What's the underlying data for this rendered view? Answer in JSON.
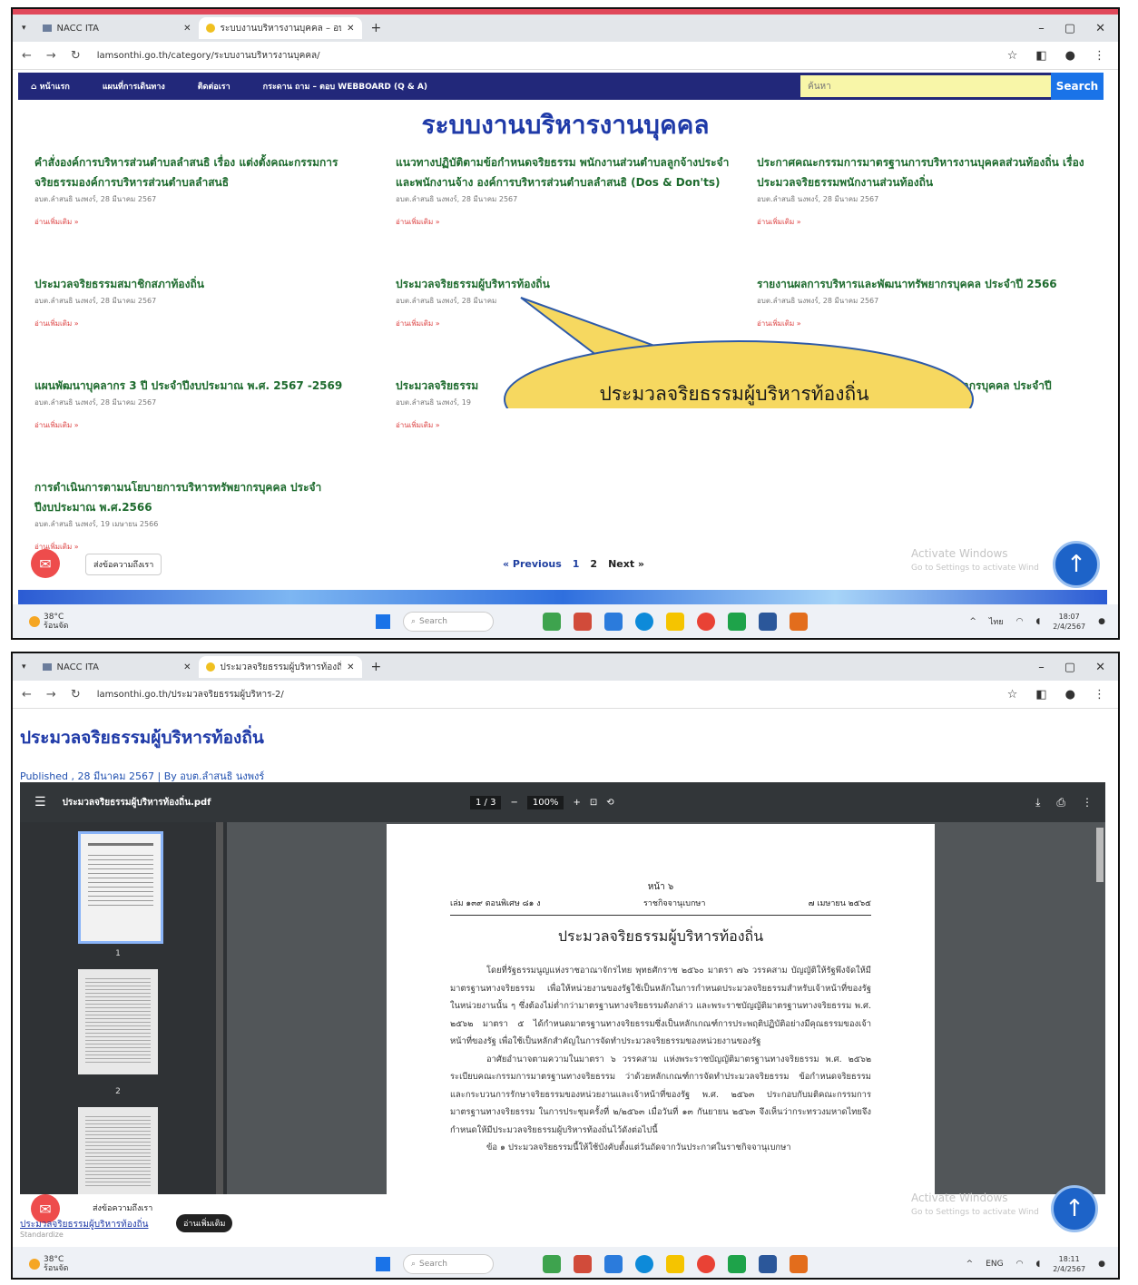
{
  "shot1": {
    "tabs": [
      {
        "title": "NACC ITA"
      },
      {
        "title": "ระบบงานบริหารงานบุคคล – อบต.ก..."
      }
    ],
    "window_controls": [
      "–",
      "▢",
      "✕"
    ],
    "url": "lamsonthi.go.th/category/ระบบงานบริหารงานบุคคล/",
    "nav_items": [
      "หน้าแรก",
      "แผนที่การเดินทาง",
      "ติดต่อเรา",
      "กระดาน ถาม – ตอบ WEBBOARD (Q & A)"
    ],
    "search_placeholder": "ค้นหา",
    "search_button": "Search",
    "page_title": "ระบบงานบริหารงานบุคคล",
    "posts": [
      {
        "title": "คำสั่งองค์การบริหารส่วนตำบลลำสนธิ เรื่อง แต่งตั้งคณะกรรมการจริยธรรมองค์การบริหารส่วนตำบลลำสนธิ",
        "meta": "อบต.ลำสนธิ นงพงร์, 28 มีนาคม 2567",
        "more": "อ่านเพิ่มเติม »"
      },
      {
        "title": "แนวทางปฏิบัติตามข้อกำหนดจริยธรรม พนักงานส่วนตำบลลูกจ้างประจำ และพนักงานจ้าง องค์การบริหารส่วนตำบลลำสนธิ (Dos & Don'ts)",
        "meta": "อบต.ลำสนธิ นงพงร์, 28 มีนาคม 2567",
        "more": "อ่านเพิ่มเติม »"
      },
      {
        "title": "ประกาศคณะกรรมการมาตรฐานการบริหารงานบุคคลส่วนท้องถิ่น เรื่อง ประมวลจริยธรรมพนักงานส่วนท้องถิ่น",
        "meta": "อบต.ลำสนธิ นงพงร์, 28 มีนาคม 2567",
        "more": "อ่านเพิ่มเติม »"
      },
      {
        "title": "ประมวลจริยธรรมสมาชิกสภาท้องถิ่น",
        "meta": "อบต.ลำสนธิ นงพงร์, 28 มีนาคม 2567",
        "more": "อ่านเพิ่มเติม »"
      },
      {
        "title": "ประมวลจริยธรรมผู้บริหารท้องถิ่น",
        "meta": "อบต.ลำสนธิ นงพงร์, 28 มีนาคม",
        "more": "อ่านเพิ่มเติม »"
      },
      {
        "title": "รายงานผลการบริหารและพัฒนาทรัพยากรบุคคล ประจำปี 2566",
        "meta": "อบต.ลำสนธิ นงพงร์, 28 มีนาคม 2567",
        "more": "อ่านเพิ่มเติม »"
      },
      {
        "title": "แผนพัฒนาบุคลากร 3 ปี ประจำปีงบประมาณ พ.ศ. 2567 -2569",
        "meta": "อบต.ลำสนธิ นงพงร์, 28 มีนาคม 2567",
        "more": "อ่านเพิ่มเติม »"
      },
      {
        "title": "ประมวลจริยธรรม",
        "meta": "อบต.ลำสนธิ นงพงร์, 19",
        "more": "อ่านเพิ่มเติม »"
      },
      {
        "title": "ยากรบุคคล ประจำปี",
        "meta": "",
        "more": ""
      },
      {
        "title": "การดำเนินการตามนโยบายการบริหารทรัพยากรบุคคล ประจำปีงบประมาณ พ.ศ.2566",
        "meta": "อบต.ลำสนธิ นงพงร์, 19 เมษายน 2566",
        "more": "อ่านเพิ่มเติม »"
      }
    ],
    "callout_text": "ประมวลจริยธรรมผู้บริหารท้องถิ่น",
    "chat_label": "ส่งข้อความถึงเรา",
    "pager": {
      "prev": "« Previous",
      "p1": "1",
      "p2": "2",
      "next": "Next »"
    },
    "activate": {
      "line1": "Activate Windows",
      "line2": "Go to Settings to activate Wind"
    },
    "weather": {
      "temp": "38°C",
      "desc": "ร้อนจัด"
    },
    "taskbar_search": "Search",
    "tray_lang": "ไทย",
    "clock": {
      "time": "18:07",
      "date": "2/4/2567"
    }
  },
  "shot2": {
    "tabs": [
      {
        "title": "NACC ITA"
      },
      {
        "title": "ประมวลจริยธรรมผู้บริหารท้องถิ่น – อ..."
      }
    ],
    "window_controls": [
      "–",
      "▢",
      "✕"
    ],
    "url": "lamsonthi.go.th/ประมวลจริยธรรมผู้บริหาร-2/",
    "post_title": "ประมวลจริยธรรมผู้บริหารท้องถิ่น",
    "published": "Published , 28 มีนาคม 2567 | By อบต.ลำสนธิ นงพงร์",
    "pdf": {
      "filename": "ประมวลจริยธรรมผู้บริหารท้องถิ่น.pdf",
      "page_indicator": "1 / 3",
      "zoom": "100%",
      "thumb_numbers": [
        "1",
        "2"
      ],
      "page_number": "หน้า ๖",
      "header_left": "เล่ม ๑๓๙ ตอนพิเศษ ๘๑ ง",
      "header_center": "ราชกิจจานุเบกษา",
      "header_right": "๗ เมษายน ๒๕๖๕",
      "doc_title": "ประมวลจริยธรรมผู้บริหารท้องถิ่น",
      "paragraphs": [
        "โดยที่รัฐธรรมนูญแห่งราชอาณาจักรไทย พุทธศักราช ๒๕๖๐ มาตรา ๗๖ วรรคสาม บัญญัติให้รัฐพึงจัดให้มีมาตรฐานทางจริยธรรม เพื่อให้หน่วยงานของรัฐใช้เป็นหลักในการกำหนดประมวลจริยธรรมสำหรับเจ้าหน้าที่ของรัฐในหน่วยงานนั้น ๆ ซึ่งต้องไม่ต่ำกว่ามาตรฐานทางจริยธรรมดังกล่าว และพระราชบัญญัติมาตรฐานทางจริยธรรม พ.ศ. ๒๕๖๒ มาตรา ๕ ได้กำหนดมาตรฐานทางจริยธรรมซึ่งเป็นหลักเกณฑ์การประพฤติปฏิบัติอย่างมีคุณธรรมของเจ้าหน้าที่ของรัฐ เพื่อใช้เป็นหลักสำคัญในการจัดทำประมวลจริยธรรมของหน่วยงานของรัฐ",
        "อาศัยอำนาจตามความในมาตรา ๖ วรรคสาม แห่งพระราชบัญญัติมาตรฐานทางจริยธรรม พ.ศ. ๒๕๖๒ ระเบียบคณะกรรมการมาตรฐานทางจริยธรรม ว่าด้วยหลักเกณฑ์การจัดทำประมวลจริยธรรม ข้อกำหนดจริยธรรม และกระบวนการรักษาจริยธรรมของหน่วยงานและเจ้าหน้าที่ของรัฐ พ.ศ. ๒๕๖๓ ประกอบกับมติคณะกรรมการมาตรฐานทางจริยธรรม ในการประชุมครั้งที่ ๒/๒๕๖๓ เมื่อวันที่ ๑๓ กันยายน ๒๕๖๓ จึงเห็นว่ากระทรวงมหาดไทยจึงกำหนดให้มีประมวลจริยธรรมผู้บริหารท้องถิ่นไว้ดังต่อไปนี้",
        "ข้อ ๑ ประมวลจริยธรรมนี้ให้ใช้บังคับตั้งแต่วันถัดจากวันประกาศในราชกิจจานุเบกษา"
      ]
    },
    "hashtag": "ประมวลจริยธรรมผู้บริหารท้องถิ่น",
    "hashsub": "Standardize",
    "read_button": "อ่านเพิ่มเติม",
    "chat_label": "ส่งข้อความถึงเรา",
    "activate": {
      "line1": "Activate Windows",
      "line2": "Go to Settings to activate Wind"
    },
    "weather": {
      "temp": "38°C",
      "desc": "ร้อนจัด"
    },
    "taskbar_search": "Search",
    "tray_lang": "ENG",
    "clock": {
      "time": "18:11",
      "date": "2/4/2567"
    }
  },
  "colors": {
    "navbar": "#22287a",
    "title_blue": "#1f3aa8",
    "post_green": "#1e6b2e",
    "callout_fill": "#f6d860",
    "scroll_top": "#1d63c8"
  }
}
